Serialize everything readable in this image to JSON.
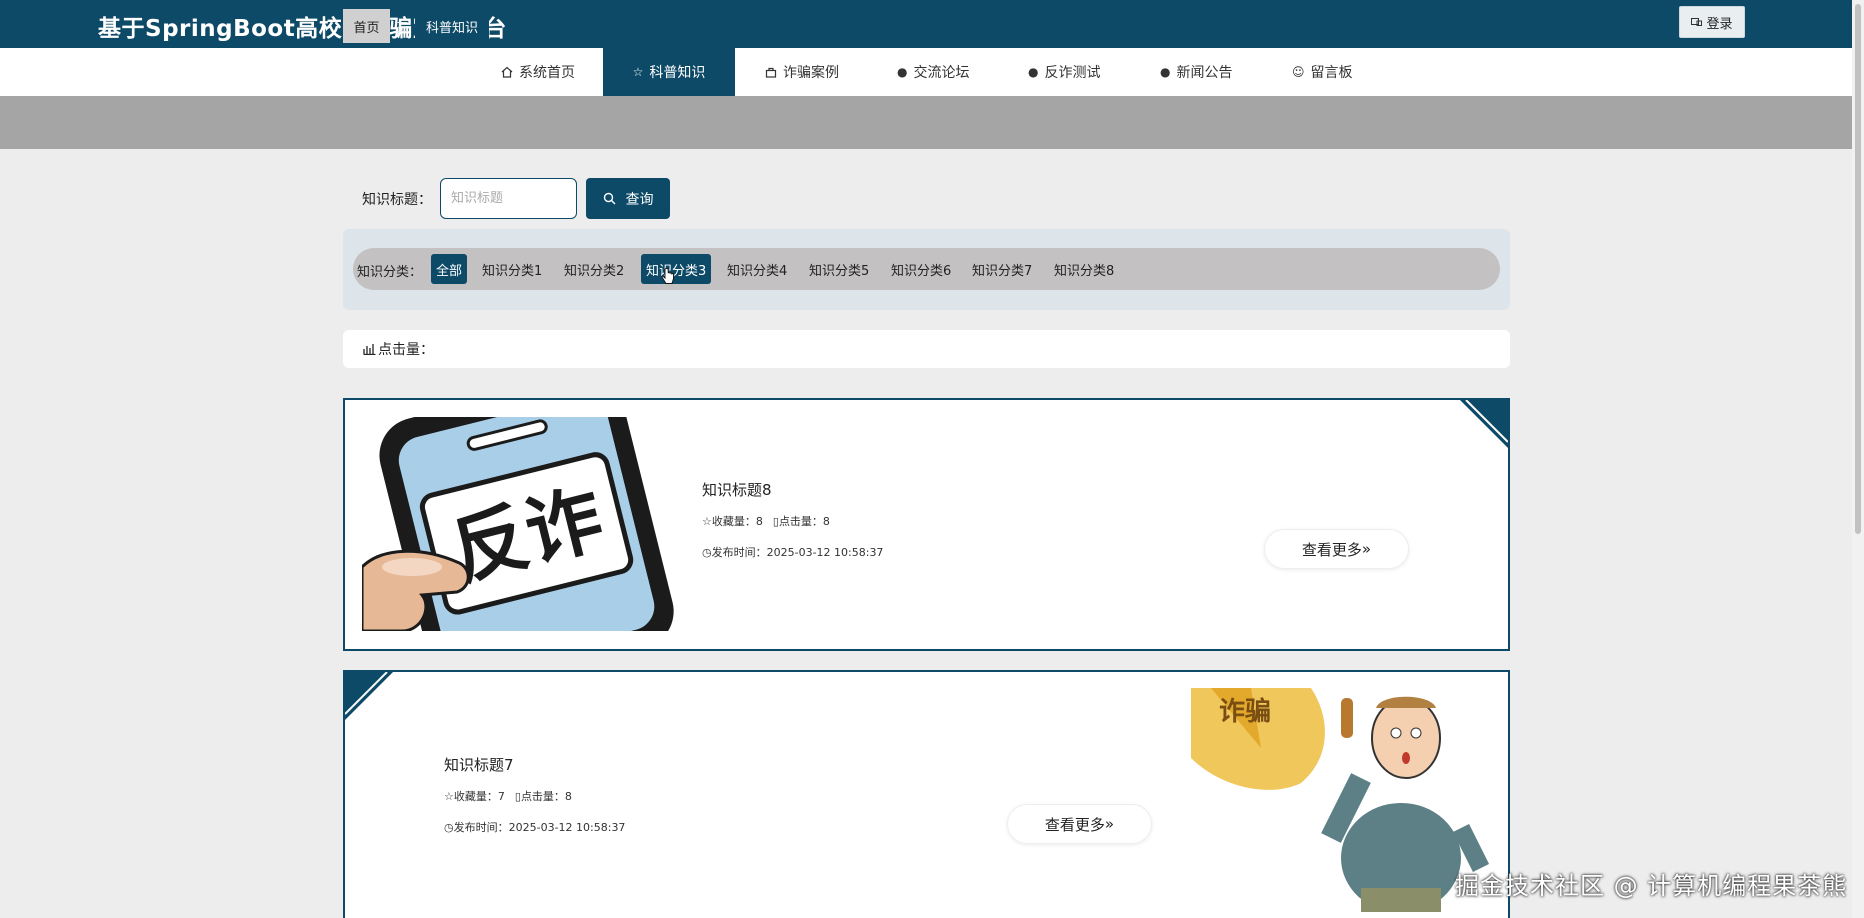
{
  "header": {
    "site_title": "基于SpringBoot高校防诈骗宣传平台",
    "login_label": "登录"
  },
  "nav": {
    "items": [
      {
        "label": "系统首页",
        "icon": "home-icon"
      },
      {
        "label": "科普知识",
        "icon": "star-icon"
      },
      {
        "label": "诈骗案例",
        "icon": "bag-icon"
      },
      {
        "label": "交流论坛",
        "icon": "alert-icon"
      },
      {
        "label": "反诈测试",
        "icon": "question-icon"
      },
      {
        "label": "新闻公告",
        "icon": "info-icon"
      },
      {
        "label": "留言板",
        "icon": "smile-icon"
      }
    ],
    "active_index": 1
  },
  "breadcrumb": {
    "home": "首页",
    "separator": "三",
    "current": "科普知识"
  },
  "search": {
    "label": "知识标题：",
    "placeholder": "知识标题",
    "button_label": "查询"
  },
  "categories": {
    "label": "知识分类：",
    "items": [
      "全部",
      "知识分类1",
      "知识分类2",
      "知识分类3",
      "知识分类4",
      "知识分类5",
      "知识分类6",
      "知识分类7",
      "知识分类8"
    ],
    "highlighted": [
      "全部",
      "知识分类3"
    ]
  },
  "sort": {
    "label": "点击量："
  },
  "cards": [
    {
      "title": "知识标题8",
      "favorites_label": "收藏量：8",
      "clicks_label": "点击量：8",
      "time_label": "发布时间：2025-03-12 10:58:37",
      "more_label": "查看更多",
      "image_text": "反诈"
    },
    {
      "title": "知识标题7",
      "favorites_label": "收藏量：7",
      "clicks_label": "点击量：8",
      "time_label": "发布时间：2025-03-12 10:58:37",
      "more_label": "查看更多",
      "image_text": "诈骗"
    }
  ],
  "watermark": "掘金技术社区 @ 计算机编程果茶熊",
  "colors": {
    "primary": "#0d4a67",
    "crumb_bar": "#a5a5a5",
    "background": "#ededed"
  }
}
